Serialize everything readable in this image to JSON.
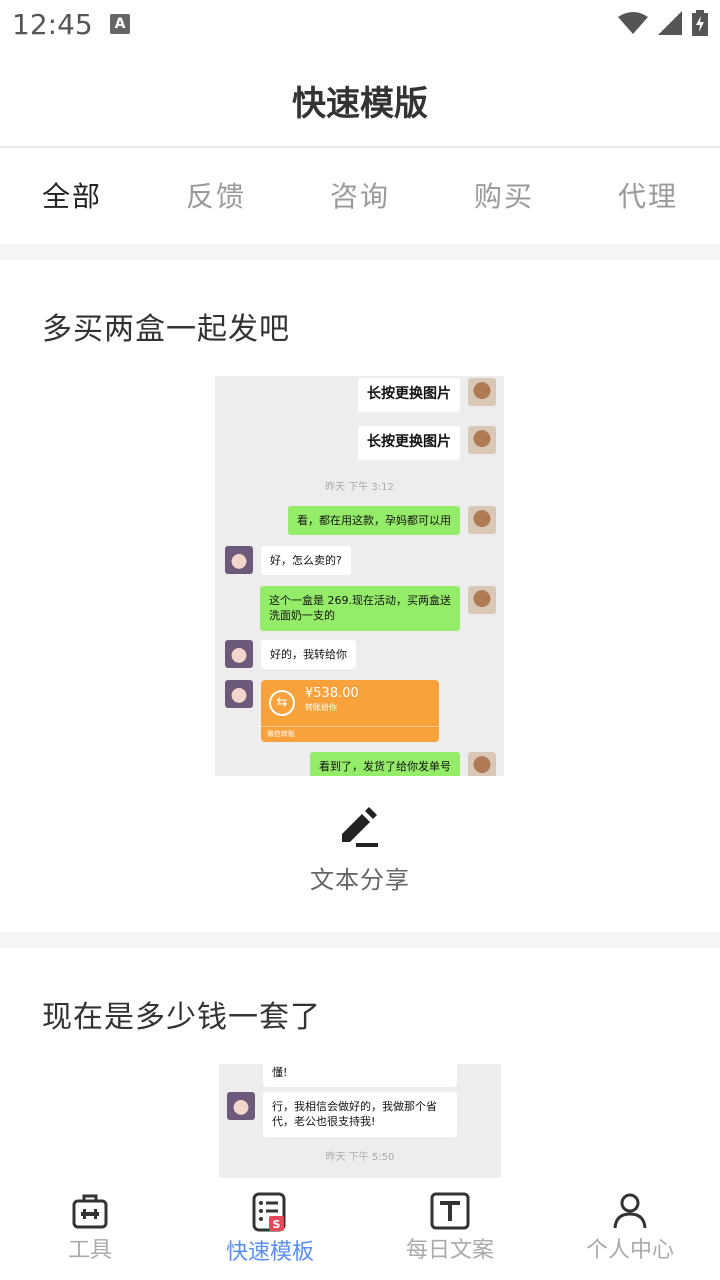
{
  "status_bar": {
    "time": "12:45",
    "notification_icon_letter": "A"
  },
  "header": {
    "title": "快速模版"
  },
  "tabs": [
    {
      "label": "全部",
      "active": true
    },
    {
      "label": "反馈",
      "active": false
    },
    {
      "label": "咨询",
      "active": false
    },
    {
      "label": "购买",
      "active": false
    },
    {
      "label": "代理",
      "active": false
    }
  ],
  "cards": [
    {
      "title": "多买两盒一起发吧",
      "chat": {
        "msg1": "长按更换图片",
        "msg2": "长按更换图片",
        "time": "昨天 下午 3:12",
        "msg3": "看，都在用这款，孕妈都可以用",
        "msg4": "好，怎么卖的?",
        "msg5": "这个一盒是 269.现在活动，买两盒送洗面奶一支的",
        "msg6": "好的，我转给你",
        "transfer_amount": "¥538.00",
        "transfer_sub": "转账给你",
        "transfer_foot": "微信转账",
        "msg7": "看到了，发货了给你发单号"
      },
      "share_label": "文本分享"
    },
    {
      "title": "现在是多少钱一套了",
      "chat": {
        "msg1": "懂!",
        "msg2": "行，我相信会做好的，我做那个省代，老公也很支持我!",
        "time": "昨天 下午 5:50"
      }
    }
  ],
  "bottom_nav": [
    {
      "label": "工具",
      "icon": "toolbox-icon",
      "active": false
    },
    {
      "label": "快速模板",
      "icon": "template-doc-icon",
      "active": true
    },
    {
      "label": "每日文案",
      "icon": "text-t-icon",
      "active": false
    },
    {
      "label": "个人中心",
      "icon": "person-icon",
      "active": false
    }
  ],
  "colors": {
    "accent": "#5b8ff2",
    "wechat_green": "#95ec69",
    "transfer_orange": "#f9a23c"
  }
}
